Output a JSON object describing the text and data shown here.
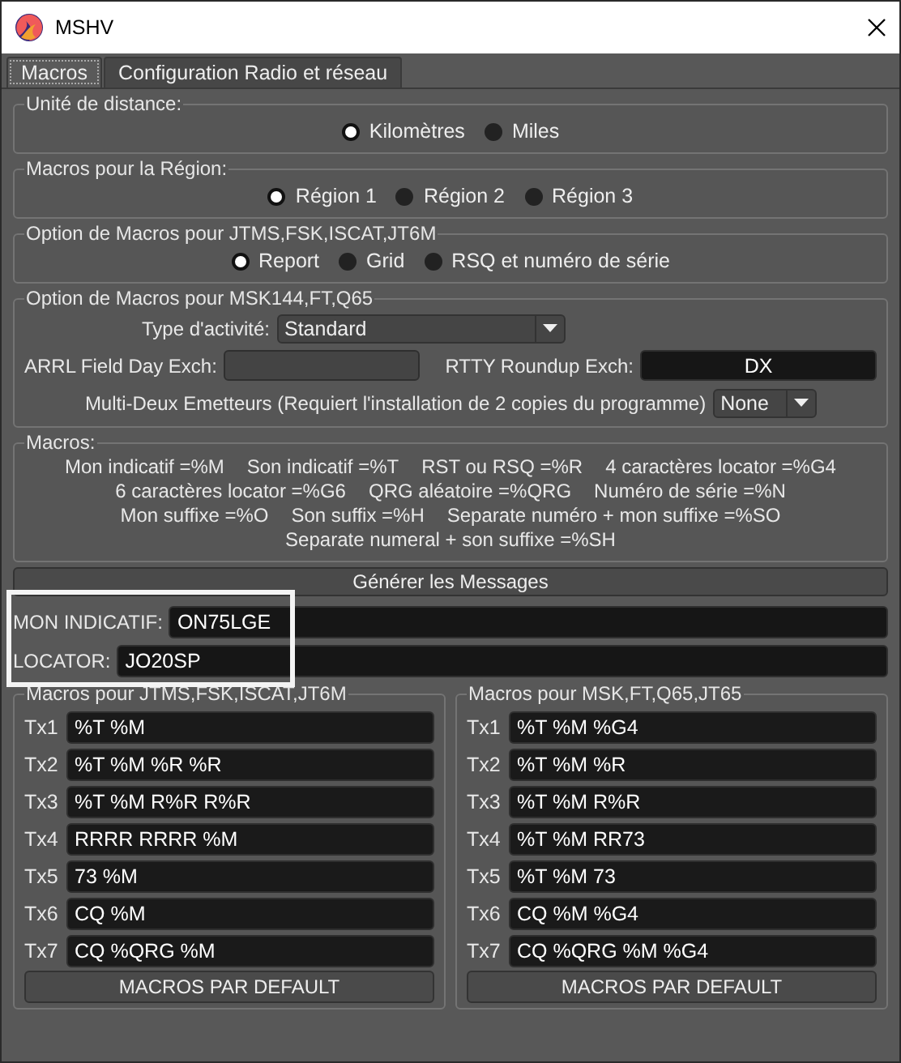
{
  "window": {
    "title": "MSHV"
  },
  "tabs": [
    {
      "label": "Macros",
      "selected": true
    },
    {
      "label": "Configuration Radio et réseau",
      "selected": false
    }
  ],
  "distance_unit": {
    "title": "Unité de distance:",
    "options": [
      {
        "label": "Kilomètres",
        "selected": true
      },
      {
        "label": "Miles",
        "selected": false
      }
    ]
  },
  "region": {
    "title": "Macros pour la Région:",
    "options": [
      {
        "label": "Région 1",
        "selected": true
      },
      {
        "label": "Région 2",
        "selected": false
      },
      {
        "label": "Région 3",
        "selected": false
      }
    ]
  },
  "jtms_options": {
    "title": "Option de Macros pour JTMS,FSK,ISCAT,JT6M",
    "options": [
      {
        "label": "Report",
        "selected": true
      },
      {
        "label": "Grid",
        "selected": false
      },
      {
        "label": "RSQ et numéro de série",
        "selected": false
      }
    ]
  },
  "msk_options": {
    "title": "Option de Macros pour MSK144,FT,Q65",
    "activity_type": {
      "label": "Type d'activité:",
      "value": "Standard"
    },
    "arrl_field_day": {
      "label": "ARRL Field Day Exch:"
    },
    "rtty_roundup": {
      "label": "RTTY Roundup Exch:",
      "value": "DX"
    },
    "multi_two": {
      "label": "Multi-Deux Emetteurs (Requiert l'installation de 2 copies du programme)",
      "value": "None"
    }
  },
  "macros_legend": {
    "title": "Macros:",
    "lines": [
      [
        "Mon indicatif =%M",
        "Son indicatif =%T",
        "RST ou RSQ =%R",
        "4 caractères locator =%G4"
      ],
      [
        "6 caractères locator =%G6",
        "QRG aléatoire =%QRG",
        "Numéro de série =%N"
      ],
      [
        "Mon suffixe =%O",
        "Son suffix =%H",
        "Separate numéro + mon suffixe =%SO"
      ],
      [
        "Separate numeral + son suffixe =%SH"
      ]
    ]
  },
  "generate_button": "Générer les Messages",
  "my_call": {
    "label": "MON INDICATIF:",
    "value": "ON75LGE"
  },
  "locator": {
    "label": "LOCATOR:",
    "value": "JO20SP"
  },
  "macro_panels": [
    {
      "title": "Macros pour JTMS,FSK,ISCAT,JT6M",
      "rows": [
        {
          "label": "Tx1",
          "value": "%T %M"
        },
        {
          "label": "Tx2",
          "value": "%T %M %R %R"
        },
        {
          "label": "Tx3",
          "value": "%T %M R%R R%R"
        },
        {
          "label": "Tx4",
          "value": "RRRR RRRR %M"
        },
        {
          "label": "Tx5",
          "value": "73 %M"
        },
        {
          "label": "Tx6",
          "value": "CQ %M"
        },
        {
          "label": "Tx7",
          "value": "CQ %QRG %M"
        }
      ],
      "default_button": "MACROS PAR DEFAULT"
    },
    {
      "title": "Macros pour MSK,FT,Q65,JT65",
      "rows": [
        {
          "label": "Tx1",
          "value": "%T %M %G4"
        },
        {
          "label": "Tx2",
          "value": "%T %M %R"
        },
        {
          "label": "Tx3",
          "value": "%T %M R%R"
        },
        {
          "label": "Tx4",
          "value": "%T %M RR73"
        },
        {
          "label": "Tx5",
          "value": "%T %M 73"
        },
        {
          "label": "Tx6",
          "value": "CQ %M %G4"
        },
        {
          "label": "Tx7",
          "value": "CQ %QRG %M %G4"
        }
      ],
      "default_button": "MACROS PAR DEFAULT"
    }
  ]
}
